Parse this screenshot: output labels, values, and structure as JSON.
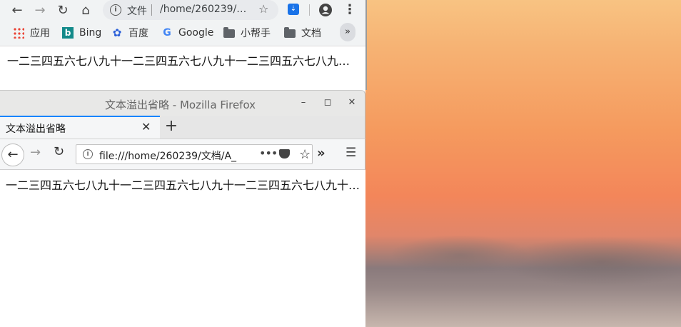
{
  "chrome": {
    "omnibox": {
      "label": "文件",
      "url": "/home/260239/…"
    },
    "bookmarks": [
      {
        "label": "应用",
        "icon": "apps-icon"
      },
      {
        "label": "Bing",
        "icon": "bing-icon"
      },
      {
        "label": "百度",
        "icon": "baidu-icon"
      },
      {
        "label": "Google",
        "icon": "google-icon"
      },
      {
        "label": "小帮手",
        "icon": "folder-icon"
      },
      {
        "label": "文档",
        "icon": "folder-icon"
      }
    ],
    "more_label": "»",
    "content_text": "一二三四五六七八九十一二三四五六七八九十一二三四五六七八九…"
  },
  "firefox": {
    "window_title": "文本溢出省略  -  Mozilla Firefox",
    "tab_title": "文本溢出省略",
    "url": "file:///home/260239/文档/A_",
    "content_text": "一二三四五六七八九十一二三四五六七八九十一二三四五六七八九十…"
  }
}
